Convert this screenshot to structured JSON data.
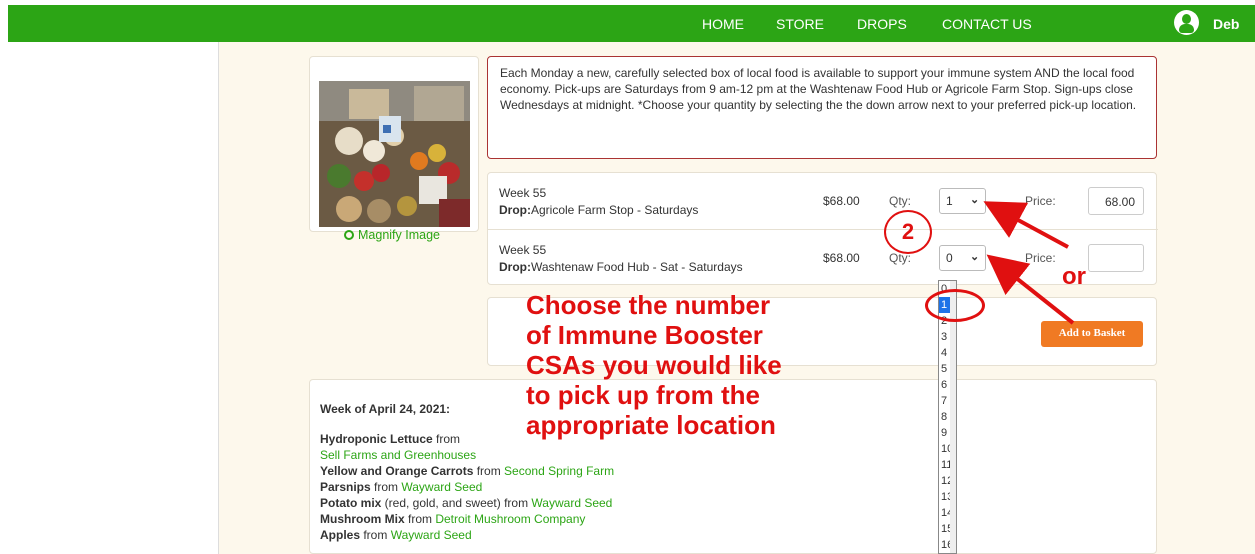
{
  "nav": {
    "links": [
      "HOME",
      "STORE",
      "DROPS",
      "CONTACT US"
    ],
    "user_name": "Deb"
  },
  "product": {
    "magnify_label": "Magnify Image",
    "description": "Each Monday a new, carefully selected box of local food is available to support your immune system AND the local food economy. Pick-ups are Saturdays from 9 am-12 pm at the Washtenaw Food Hub or Agricole Farm Stop. Sign-ups close Wednesdays at midnight. *Choose your quantity by selecting the the down arrow next to your preferred pick-up location.",
    "rows": [
      {
        "week": "Week 55",
        "drop_label": "Drop:",
        "drop": "Agricole Farm Stop - Saturdays",
        "amount": "$68.00",
        "qty_label": "Qty:",
        "qty": "1",
        "price_label": "Price:",
        "price": "68.00"
      },
      {
        "week": "Week 55",
        "drop_label": "Drop:",
        "drop": "Washtenaw Food Hub - Sat - Saturdays",
        "amount": "$68.00",
        "qty_label": "Qty:",
        "qty": "0",
        "price_label": "Price:",
        "price": ""
      }
    ],
    "add_button": "Add to Basket"
  },
  "dropdown": {
    "options": [
      "0",
      "1",
      "2",
      "3",
      "4",
      "5",
      "6",
      "7",
      "8",
      "9",
      "10",
      "11",
      "12",
      "13",
      "14",
      "15",
      "16"
    ],
    "selected": "1"
  },
  "info": {
    "heading": "Week of April 24, 2021:",
    "items": [
      {
        "name": "Hydroponic Lettuce",
        "from": " from",
        "source": ""
      },
      {
        "name": "",
        "from": "",
        "source": "Sell Farms and Greenhouses"
      },
      {
        "name": "Yellow and Orange Carrots",
        "from": " from ",
        "source": "Second Spring Farm"
      },
      {
        "name": "Parsnips",
        "from": " from ",
        "source": "Wayward Seed"
      },
      {
        "name": "Potato mix",
        "from": " (red, gold, and sweet) from ",
        "source": "Wayward Seed"
      },
      {
        "name": "Mushroom Mix",
        "from": " from ",
        "source": "Detroit Mushroom Company"
      },
      {
        "name": "Apples",
        "from": " from ",
        "source": "Wayward Seed"
      }
    ]
  },
  "annotation": {
    "lines": [
      "Choose the number",
      "of Immune Booster",
      "CSAs you would like",
      "to pick up from the",
      "appropriate location"
    ],
    "step": "2",
    "or": "or",
    "color": "#e01010"
  },
  "colors": {
    "nav": "#2ca515",
    "button": "#f07a23",
    "link": "#2ca515"
  }
}
